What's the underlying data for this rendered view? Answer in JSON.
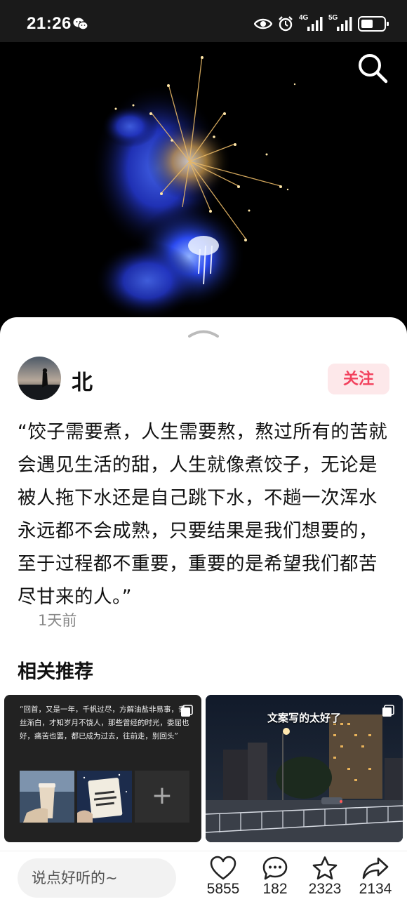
{
  "status_bar": {
    "time": "21:26",
    "network_4g": "4G",
    "network_5g": "5G",
    "battery_level": 0.55
  },
  "icons": {
    "wechat": "wechat-icon",
    "eye": "eye-icon",
    "alarm": "alarm-icon",
    "signal": "signal-icon",
    "battery": "battery-icon",
    "search": "search-icon",
    "handle": "chevron-up-icon",
    "heart": "heart-icon",
    "comment": "comment-icon",
    "star": "star-icon",
    "share": "share-icon"
  },
  "post": {
    "username": "北",
    "follow_label": "关注",
    "text": "“饺子需要煮，人生需要熬，熬过所有的苦就会遇见生活的甜，人生就像煮饺子，无论是被人拖下水还是自己跳下水，不趟一次浑水永远都不会成熟，只要结果是我们想要的，至于过程都不重要，重要的是希望我们都苦尽甘来的人。”",
    "time": "1天前"
  },
  "related": {
    "title": "相关推荐",
    "card1_text": "“回首，又是一年，千帆过尽，方解油盐非易事，青丝渐白，才知岁月不饶人，那些曾经的时光，委屈也好，痛苦也罢，都已成为过去，往前走，别回头”",
    "card1_plus": "+",
    "card2_caption": "文案写的太好了"
  },
  "bottom_bar": {
    "comment_placeholder": "说点好听的~",
    "likes": "5855",
    "comments": "182",
    "favorites": "2323",
    "shares": "2134"
  },
  "colors": {
    "accent": "#f2415d",
    "follow_bg": "#fde8ea",
    "sheet_bg": "#ffffff"
  }
}
